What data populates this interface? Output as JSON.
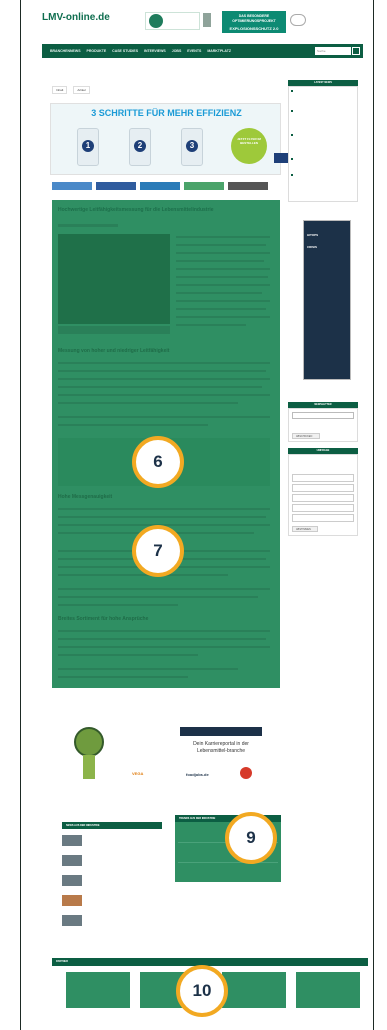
{
  "header": {
    "logo": "LMV-online.de",
    "banner_title": "DAS BESONDERE OPTIMIERUNGSPROJEKT",
    "banner_sub": "EXPLOSIONSSCHUTZ 2.0"
  },
  "nav": {
    "items": [
      "BRANCHENNEWS",
      "PRODUKTE",
      "CASE STUDIES",
      "INTERVIEWS",
      "JOBS",
      "EVENTS",
      "MARKTPLATZ"
    ],
    "search_placeholder": "Suche"
  },
  "tabs": [
    "Inhalt",
    "Artikel"
  ],
  "ad_top": {
    "title": "3 SCHRITTE FÜR MEHR EFFIZIENZ",
    "numbers": [
      "1",
      "2",
      "3"
    ],
    "badge": "JETZT FLYER IM BESTELLEN"
  },
  "article": {
    "title": "Hochwertige Leitfähigkeitsmessung für die Lebensmittelindustrie",
    "heading_1": "Messung von hoher und niedriger Leitfähigkeit",
    "heading_2": "Hohe Messgenauigkeit",
    "heading_3": "Breites Sortiment für hohe Ansprüche"
  },
  "sidebar": {
    "head_news": "LATEST NEWS",
    "head_newsletter": "NEWSLETTER",
    "head_survey": "UMFRAGE",
    "newsletter_button": "ABSCHICKEN",
    "survey_button": "ABSTIMMEN",
    "sky_brand": "HITOPS",
    "sky_tag": "CRISIS"
  },
  "ads_bottom": {
    "vega_brand": "VEGA",
    "food_text": "Dein Karriereportal in der Lebensmittel-branche",
    "food_brand": "foodjobs.de"
  },
  "widgets": {
    "news_head": "NEWS AUS DER INDUSTRIE",
    "tops_head": "TRENDS AUS DER INDUSTRIE",
    "partner_head": "PARTNER"
  },
  "markers": [
    "6",
    "7",
    "9",
    "10"
  ]
}
